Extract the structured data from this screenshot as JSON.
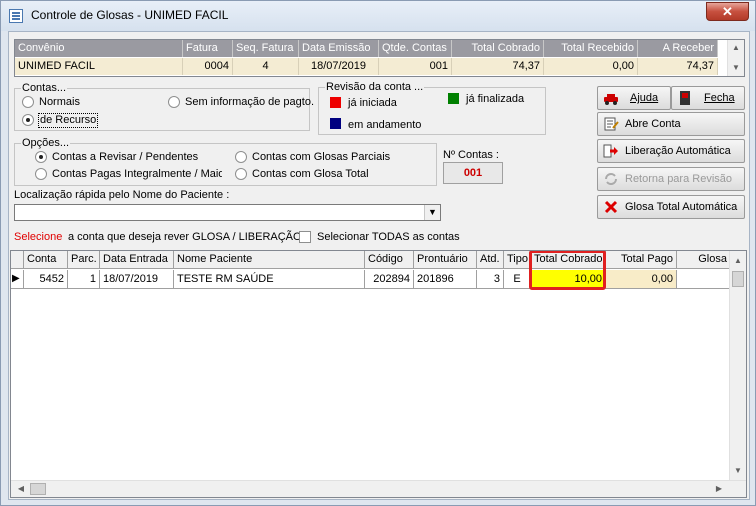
{
  "window": {
    "title": "Controle de Glosas - UNIMED FACIL",
    "close": "✕"
  },
  "top_table": {
    "headers": [
      "Convênio",
      "Fatura",
      "Seq. Fatura",
      "Data Emissão",
      "Qtde. Contas",
      "Total Cobrado",
      "Total Recebido",
      "A Receber"
    ],
    "row": [
      "UNIMED FACIL",
      "0004",
      "4",
      "18/07/2019",
      "001",
      "74,37",
      "0,00",
      "74,37"
    ]
  },
  "contas": {
    "title": "Contas...",
    "options": [
      "Normais",
      "Sem informação de pagto.",
      "de Recurso"
    ],
    "selected": "de Recurso"
  },
  "revisao": {
    "title": "Revisão da conta ...",
    "legend": [
      {
        "label": "já iniciada",
        "color": "#ee0000"
      },
      {
        "label": "já finalizada",
        "color": "#008000"
      },
      {
        "label": "em andamento",
        "color": "#000080"
      }
    ]
  },
  "opcoes": {
    "title": "Opções...",
    "options": [
      "Contas a Revisar / Pendentes",
      "Contas com Glosas Parciais",
      "Contas Pagas Integralmente / Maior",
      "Contas com Glosa Total"
    ],
    "selected": "Contas a Revisar / Pendentes"
  },
  "nconta": {
    "label": "Nº Contas :",
    "value": "001"
  },
  "buttons": {
    "ajuda": "Ajuda",
    "fecha": "Fecha",
    "abre_conta": "Abre Conta",
    "liberacao": "Liberação Automática",
    "retorna": "Retorna para Revisão",
    "glosa_total": "Glosa Total Automática"
  },
  "localizacao": {
    "label": "Localização rápida pelo Nome do Paciente :",
    "value": ""
  },
  "instruction": {
    "highlight": "Selecione",
    "text": "a conta que deseja rever GLOSA / LIBERAÇÃO:",
    "select_all": "Selecionar TODAS as contas"
  },
  "grid": {
    "headers": [
      "Conta",
      "Parc.",
      "Data Entrada",
      "Nome Paciente",
      "Código",
      "Prontuário",
      "Atd.",
      "Tipo",
      "Total Cobrado",
      "Total Pago",
      "Glosa"
    ],
    "rows": [
      [
        "5452",
        "1",
        "18/07/2019",
        "TESTE RM SAÚDE",
        "202894",
        "201896",
        "3",
        "E",
        "10,00",
        "0,00",
        ""
      ]
    ],
    "row_indicator": "▶"
  },
  "colors": {
    "highlight_box": "#e02020",
    "total_cobrado_bg": "#ffff00",
    "total_pago_bg": "#f8ecc8"
  }
}
